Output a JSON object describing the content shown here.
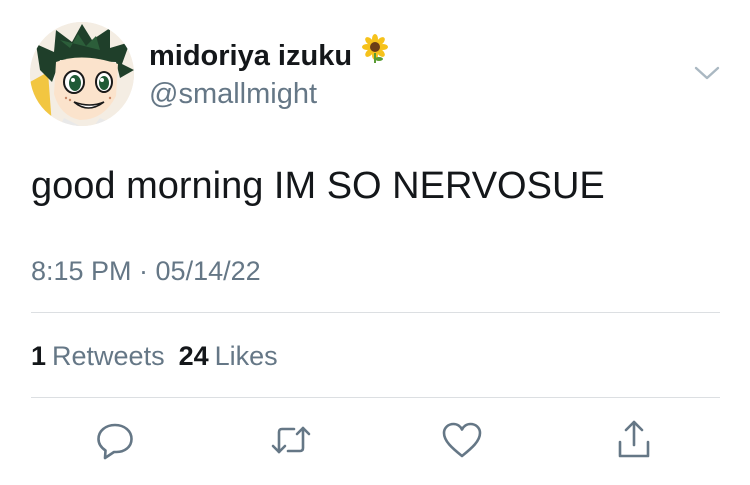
{
  "tweet": {
    "display_name": "midoriya izuku",
    "name_emoji": "sunflower-icon",
    "handle": "@smallmight",
    "text": "good morning IM SO NERVOSUE",
    "timestamp": "8:15 PM · 05/14/22"
  },
  "stats": {
    "retweets_count": "1",
    "retweets_label": "Retweets",
    "likes_count": "24",
    "likes_label": "Likes"
  },
  "actions": [
    "reply-icon",
    "retweet-icon",
    "like-icon",
    "share-icon"
  ],
  "colors": {
    "primary_text": "#14171a",
    "secondary_text": "#657786",
    "divider": "#dcdfe2",
    "icon": "#657786"
  }
}
